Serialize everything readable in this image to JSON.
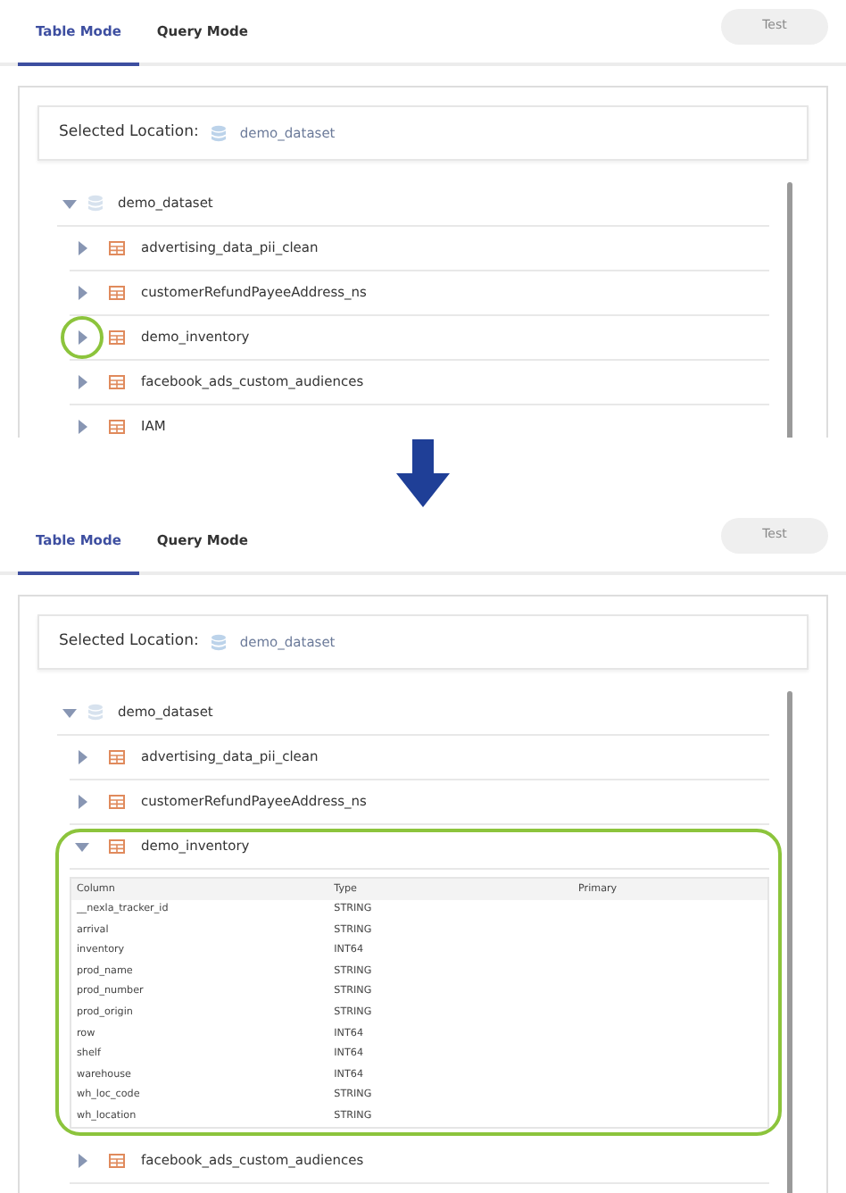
{
  "panels": [
    {
      "tabs": [
        {
          "label": "Table Mode",
          "selected": true
        },
        {
          "label": "Query Mode",
          "selected": false
        }
      ],
      "test_button": {
        "label": "Test",
        "disabled": true
      },
      "location": {
        "label": "Selected Location:",
        "value": "demo_dataset"
      },
      "tree": {
        "label": "demo_dataset",
        "expanded": true,
        "children": [
          {
            "label": "advertising_data_pii_clean",
            "expanded": false,
            "highlighted": false
          },
          {
            "label": "customerRefundPayeeAddress_ns",
            "expanded": false,
            "highlighted": false
          },
          {
            "label": "demo_inventory",
            "expanded": false,
            "highlighted": true
          },
          {
            "label": "facebook_ads_custom_audiences",
            "expanded": false,
            "highlighted": false
          },
          {
            "label": "IAM",
            "expanded": false,
            "highlighted": false
          }
        ]
      }
    },
    {
      "tabs": [
        {
          "label": "Table Mode",
          "selected": true
        },
        {
          "label": "Query Mode",
          "selected": false
        }
      ],
      "test_button": {
        "label": "Test",
        "disabled": true
      },
      "location": {
        "label": "Selected Location:",
        "value": "demo_dataset"
      },
      "tree": {
        "label": "demo_dataset",
        "expanded": true,
        "children": [
          {
            "label": "advertising_data_pii_clean",
            "expanded": false,
            "highlighted": false
          },
          {
            "label": "customerRefundPayeeAddress_ns",
            "expanded": false,
            "highlighted": false
          },
          {
            "label": "demo_inventory",
            "expanded": true,
            "highlighted": true,
            "table": {
              "columns": [
                "Column",
                "Type",
                "Primary"
              ],
              "rows": [
                [
                  "__nexla_tracker_id",
                  "STRING"
                ],
                [
                  "arrival",
                  "STRING"
                ],
                [
                  "inventory",
                  "INT64"
                ],
                [
                  "prod_name",
                  "STRING"
                ],
                [
                  "prod_number",
                  "STRING"
                ],
                [
                  "prod_origin",
                  "STRING"
                ],
                [
                  "row",
                  "INT64"
                ],
                [
                  "shelf",
                  "INT64"
                ],
                [
                  "warehouse",
                  "INT64"
                ],
                [
                  "wh_loc_code",
                  "STRING"
                ],
                [
                  "wh_location",
                  "STRING"
                ]
              ]
            }
          },
          {
            "label": "facebook_ads_custom_audiences",
            "expanded": false,
            "highlighted": false
          }
        ]
      }
    }
  ]
}
